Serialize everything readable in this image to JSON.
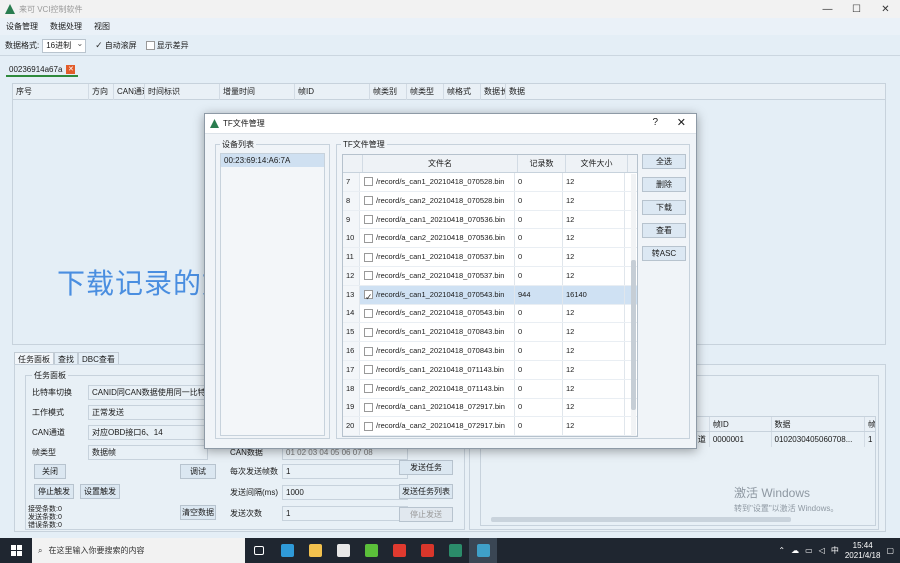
{
  "window": {
    "title": "来可 VCI控制软件",
    "controls": [
      "—",
      "☐",
      "✕"
    ]
  },
  "menu": [
    "设备管理",
    "数据处理",
    "视图"
  ],
  "toolbar": {
    "format_label": "数据格式:",
    "format_value": "16进制",
    "auto_scroll_label": "自动滚屏",
    "show_diff_label": "显示差异"
  },
  "doc_tab": {
    "label": "00236914a67a",
    "close": "✕"
  },
  "grid": {
    "columns": [
      "序号",
      "方向",
      "CAN通道",
      "时间标识",
      "增量时间",
      "帧ID",
      "帧类别",
      "帧类型",
      "帧格式",
      "数据长",
      "数据"
    ]
  },
  "watermark_text": "下载记录的文件",
  "bottom_tabs": [
    "任务面板",
    "查找",
    "DBC查看"
  ],
  "task_panel": {
    "legend": "任务面板",
    "fields": [
      {
        "label": "比特率切换",
        "value": "CANID同CAN数据使用同一比特率"
      },
      {
        "label": "工作模式",
        "value": "正常发送"
      },
      {
        "label": "CAN通道",
        "value": "对应OBD接口6、14"
      },
      {
        "label": "帧类型",
        "value": "数据帧"
      }
    ],
    "can_data_label": "CAN数据",
    "can_data_value": "01 02 03 04 05 06 07 08",
    "per_send_label": "每次发送帧数",
    "per_send_value": "1",
    "interval_label": "发送间隔(ms)",
    "interval_value": "1000",
    "send_count_label": "发送次数",
    "send_count_value": "1",
    "buttons": {
      "close": "关闭",
      "debug": "调试",
      "stop_trigger": "停止触发",
      "set_trigger": "设置触发",
      "clear_data": "清空数据",
      "send_task": "发送任务",
      "send_task_list": "发送任务列表",
      "stop_send": "停止发送"
    },
    "counters": [
      "接受条数:0",
      "发送条数:0",
      "错误条数:0"
    ]
  },
  "right_table": {
    "columns": [
      "",
      "帧ID",
      "数据",
      "帧"
    ],
    "rows": [
      [
        "道",
        "0000001",
        "0102030405060708...",
        "1"
      ]
    ]
  },
  "activation": {
    "line1": "激活 Windows",
    "line2": "转到\"设置\"以激活 Windows。"
  },
  "dialog": {
    "title": "TF文件管理",
    "help": "?",
    "close": "✕",
    "device_group": "设备列表",
    "devices": [
      "00:23:69:14:A6:7A"
    ],
    "tf_group": "TF文件管理",
    "columns": [
      "",
      "文件名",
      "记录数",
      "文件大小"
    ],
    "files": [
      {
        "no": "7",
        "name": "/record/s_can1_20210418_070528.bin",
        "count": "0",
        "size": "12",
        "checked": false
      },
      {
        "no": "8",
        "name": "/record/s_can2_20210418_070528.bin",
        "count": "0",
        "size": "12",
        "checked": false
      },
      {
        "no": "9",
        "name": "/record/a_can1_20210418_070536.bin",
        "count": "0",
        "size": "12",
        "checked": false
      },
      {
        "no": "10",
        "name": "/record/a_can2_20210418_070536.bin",
        "count": "0",
        "size": "12",
        "checked": false
      },
      {
        "no": "11",
        "name": "/record/s_can1_20210418_070537.bin",
        "count": "0",
        "size": "12",
        "checked": false
      },
      {
        "no": "12",
        "name": "/record/s_can2_20210418_070537.bin",
        "count": "0",
        "size": "12",
        "checked": false
      },
      {
        "no": "13",
        "name": "/record/s_can1_20210418_070543.bin",
        "count": "944",
        "size": "16140",
        "checked": true
      },
      {
        "no": "14",
        "name": "/record/s_can2_20210418_070543.bin",
        "count": "0",
        "size": "12",
        "checked": false
      },
      {
        "no": "15",
        "name": "/record/s_can1_20210418_070843.bin",
        "count": "0",
        "size": "12",
        "checked": false
      },
      {
        "no": "16",
        "name": "/record/s_can2_20210418_070843.bin",
        "count": "0",
        "size": "12",
        "checked": false
      },
      {
        "no": "17",
        "name": "/record/s_can1_20210418_071143.bin",
        "count": "0",
        "size": "12",
        "checked": false
      },
      {
        "no": "18",
        "name": "/record/s_can2_20210418_071143.bin",
        "count": "0",
        "size": "12",
        "checked": false
      },
      {
        "no": "19",
        "name": "/record/a_can1_20210418_072917.bin",
        "count": "0",
        "size": "12",
        "checked": false
      },
      {
        "no": "20",
        "name": "/record/a_can2_20210418_072917.bin",
        "count": "0",
        "size": "12",
        "checked": false
      }
    ],
    "selected_index": 6,
    "buttons": [
      "全选",
      "删除",
      "下载",
      "查看",
      "转ASC"
    ]
  },
  "taskbar": {
    "search_placeholder": "在这里输入你要搜索的内容",
    "time": "15:44",
    "date": "2021/4/18",
    "ime": "中",
    "app_icons": [
      {
        "name": "task-view-icon",
        "color": "#ffffff"
      },
      {
        "name": "edge-icon",
        "color": "#2f9ad8"
      },
      {
        "name": "file-explorer-icon",
        "color": "#f2c14e"
      },
      {
        "name": "store-icon",
        "color": "#e8e8e8"
      },
      {
        "name": "green-app-icon",
        "color": "#5bbf3a"
      },
      {
        "name": "red-app-icon",
        "color": "#e03a2f"
      },
      {
        "name": "wps-icon",
        "color": "#d9362b"
      },
      {
        "name": "vci-app-icon",
        "color": "#2b8c6a"
      },
      {
        "name": "vci-active-icon",
        "color": "#3fa0c8"
      }
    ]
  },
  "colors": {
    "accent_green": "#2f8a3c",
    "watermark_blue": "#4a8ee0",
    "selection": "#cfe1f3",
    "taskbar": "#1f2630"
  }
}
